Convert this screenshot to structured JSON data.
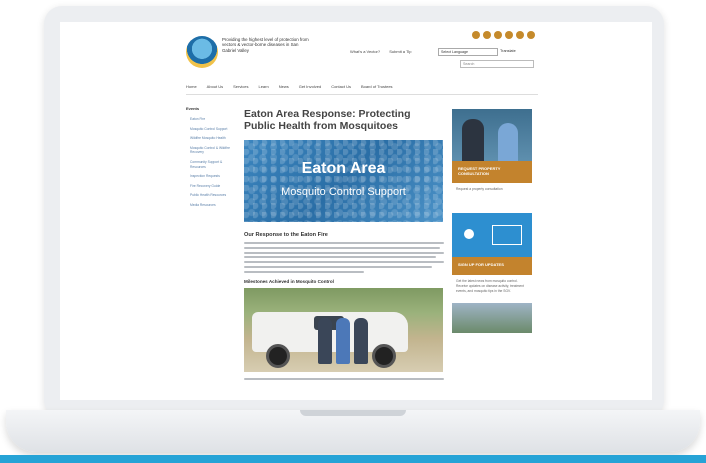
{
  "colors": {
    "accent_orange": "#c3832d",
    "accent_blue": "#2d8fd0",
    "bottom_bar": "#26a3d6"
  },
  "header": {
    "tagline": "Providing the highest level of protection from vectors & vector-borne diseases in San Gabriel Valley",
    "utility_links": [
      "What's a Vector?",
      "Submit a Tip"
    ],
    "language_select": "Select Language",
    "language_label": "Translate",
    "search_placeholder": "Search",
    "social_icons": [
      "social-icon-1",
      "social-icon-2",
      "social-icon-3",
      "social-icon-4",
      "social-icon-5",
      "social-icon-6"
    ]
  },
  "nav": [
    "Home",
    "About Us",
    "Services",
    "Learn",
    "News",
    "Get Involved",
    "Contact Us",
    "Board of Trustees"
  ],
  "sidebar": {
    "title": "Events",
    "items": [
      "Eaton Fire",
      "Mosquito Control Support",
      "Wildfire Mosquito Health",
      "Mosquito Control & Wildfire Recovery",
      "Community Support & Resources",
      "Inspection Requests",
      "Fire Recovery Guide",
      "Public Health Resources",
      "Media Resources"
    ]
  },
  "main": {
    "title": "Eaton Area Response: Protecting Public Health from Mosquitoes",
    "hero_title": "Eaton Area",
    "hero_subtitle": "Mosquito Control Support",
    "section_heading": "Our Response to the Eaton Fire",
    "sub_heading": "Milestones Achieved in Mosquito Control"
  },
  "right": {
    "promo_label": "REQUEST PROPERTY CONSULTATION",
    "promo_text": "Request a property consultation",
    "signup_label": "SIGN UP FOR UPDATES",
    "signup_text": "Get the latest news from mosquito control. Receive updates on disease activity, treatment events, and mosquito tips in the SGV."
  }
}
